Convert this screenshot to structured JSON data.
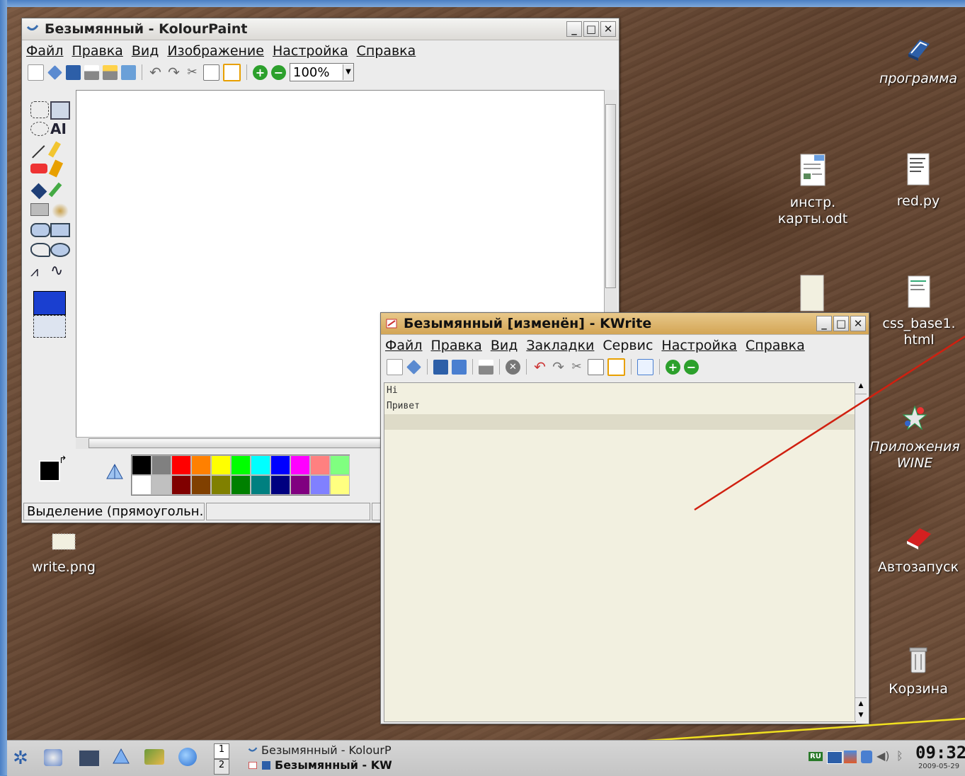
{
  "desktop": {
    "icons": [
      {
        "label": "программа"
      },
      {
        "label": "инстр. карты.odt"
      },
      {
        "label": "red.py"
      },
      {
        "label": "css_base1. html"
      },
      {
        "label": "Приложения WINE"
      },
      {
        "label": "Автозапуск"
      },
      {
        "label": "Корзина"
      },
      {
        "label": "write.png"
      }
    ]
  },
  "kolourpaint": {
    "title": "Безымянный - KolourPaint",
    "menu": [
      "Файл",
      "Правка",
      "Вид",
      "Изображение",
      "Настройка",
      "Справка"
    ],
    "zoom": "100%",
    "status": "Выделение (прямоугольн...",
    "palette_top": [
      "#000000",
      "#808080",
      "#ff0000",
      "#ff8000",
      "#ffff00",
      "#00ff00",
      "#00ffff",
      "#0000ff",
      "#ff00ff",
      "#ff8080",
      "#80ff80"
    ],
    "palette_bottom": [
      "#ffffff",
      "#c0c0c0",
      "#800000",
      "#804000",
      "#808000",
      "#008000",
      "#008080",
      "#000080",
      "#800080",
      "#8080ff",
      "#ffff80"
    ]
  },
  "kwrite": {
    "title": "Безымянный [изменён] - KWrite",
    "menu": [
      "Файл",
      "Правка",
      "Вид",
      "Закладки",
      "Сервис",
      "Настройка",
      "Справка"
    ],
    "lines": [
      "Hi",
      "Привет"
    ]
  },
  "taskbar": {
    "pager": [
      "1",
      "2"
    ],
    "tasks": [
      {
        "label": "Безымянный - KolourP"
      },
      {
        "label": "Безымянный - KW"
      }
    ],
    "lang": "RU",
    "clock_time": "09:32",
    "clock_date": "2009-05-29"
  },
  "colors": {
    "accent_title": "#d3a555",
    "editor_bg": "#f2f0e0"
  }
}
